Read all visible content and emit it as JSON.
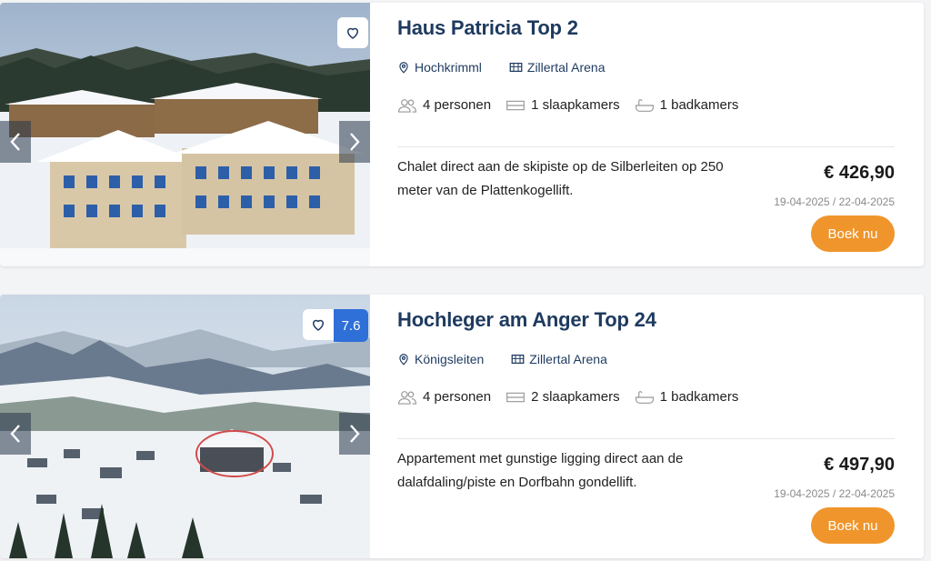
{
  "listings": [
    {
      "title": "Haus Patricia Top 2",
      "location": "Hochkrimml",
      "area": "Zillertal Arena",
      "persons": "4 personen",
      "bedrooms": "1 slaapkamers",
      "bathrooms": "1 badkamers",
      "description": "Chalet direct aan de skipiste op de Silberleiten op 250 meter van de Plattenkogellift.",
      "price": "€ 426,90",
      "dates": "19-04-2025 / 22-04-2025",
      "book_label": "Boek nu",
      "score": null
    },
    {
      "title": "Hochleger am Anger Top 24",
      "location": "Königsleiten",
      "area": "Zillertal Arena",
      "persons": "4 personen",
      "bedrooms": "2 slaapkamers",
      "bathrooms": "1 badkamers",
      "description": "Appartement met gunstige ligging direct aan de dalafdaling/piste en Dorfbahn gondellift.",
      "price": "€ 497,90",
      "dates": "19-04-2025 / 22-04-2025",
      "book_label": "Boek nu",
      "score": "7.6"
    }
  ],
  "colors": {
    "title": "#1e3a5f",
    "book_button": "#f0952b",
    "score_badge": "#2f6fd8"
  },
  "icons": {
    "favorite": "heart-icon",
    "location": "map-pin-icon",
    "area": "ski-area-icon",
    "persons": "persons-icon",
    "bedrooms": "bed-icon",
    "bathrooms": "bathtub-icon",
    "prev": "chevron-left-icon",
    "next": "chevron-right-icon"
  }
}
